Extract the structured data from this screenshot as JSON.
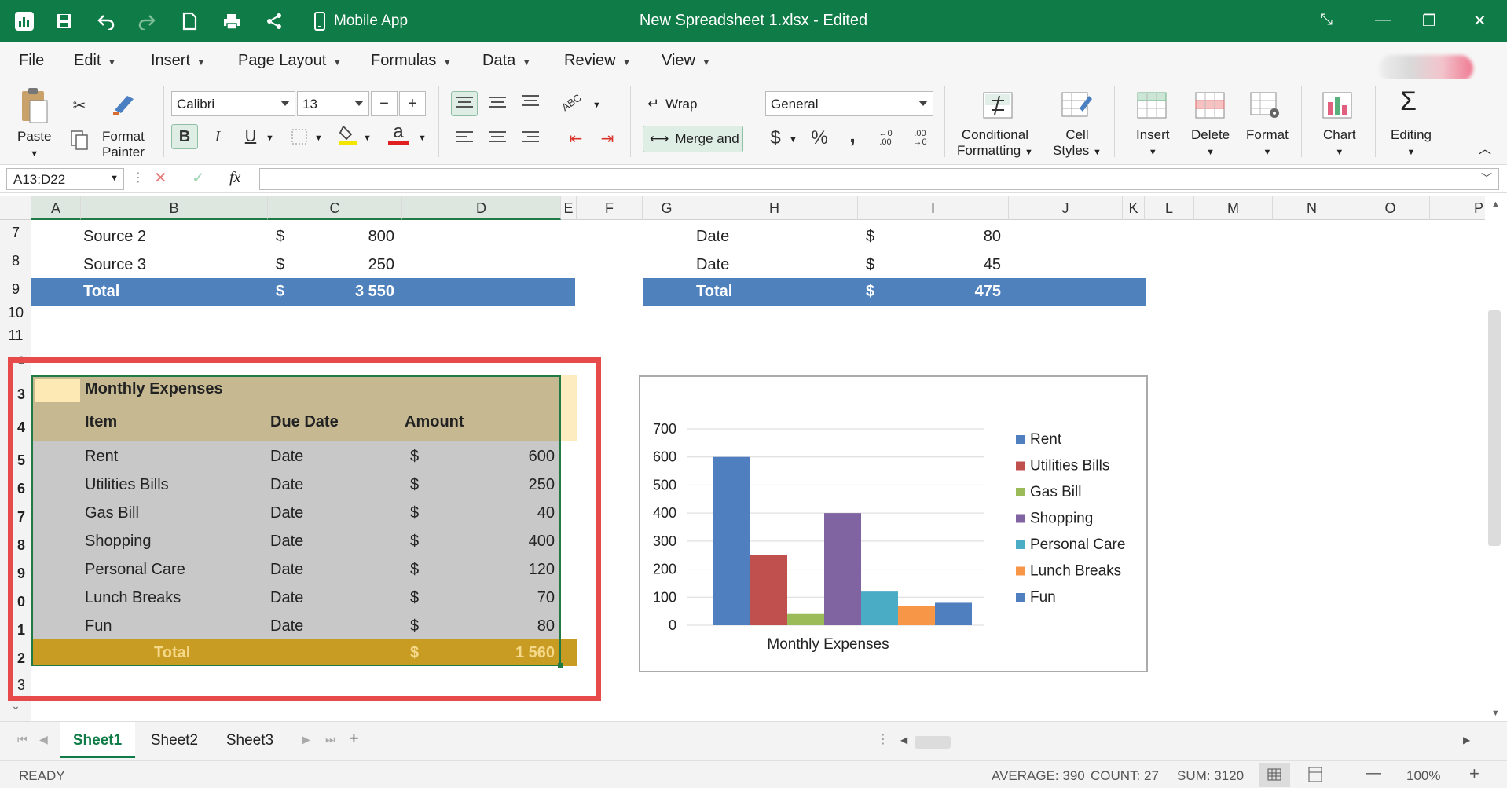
{
  "titlebar": {
    "mobile_label": "Mobile App",
    "title": "New Spreadsheet 1.xlsx - Edited"
  },
  "menu": [
    {
      "label": "File"
    },
    {
      "label": "Edit"
    },
    {
      "label": "Insert"
    },
    {
      "label": "Page Layout"
    },
    {
      "label": "Formulas"
    },
    {
      "label": "Data"
    },
    {
      "label": "Review"
    },
    {
      "label": "View"
    }
  ],
  "ribbon": {
    "paste": "Paste",
    "format_painter": [
      "Format",
      "Painter"
    ],
    "font_name": "Calibri",
    "font_size": "13",
    "wrap": "Wrap",
    "merge": "Merge and",
    "number_format": "General",
    "conditional": [
      "Conditional",
      "Formatting"
    ],
    "cell_styles": [
      "Cell",
      "Styles"
    ],
    "insert": "Insert",
    "delete": "Delete",
    "format": "Format",
    "chart": "Chart",
    "editing": "Editing",
    "bold": "B",
    "italic": "I",
    "underline": "U",
    "font_color_glyph": "a",
    "currency": "$",
    "percent": "%",
    "comma": ",",
    "sigma": "Σ",
    "abc": "ABC"
  },
  "formula_bar": {
    "name_box": "A13:D22",
    "fx": "fx",
    "value": ""
  },
  "columns": [
    "A",
    "B",
    "C",
    "D",
    "E",
    "F",
    "G",
    "H",
    "I",
    "J",
    "K",
    "L",
    "M",
    "N",
    "O",
    "P"
  ],
  "rows_top": [
    {
      "num": "7",
      "b": "Source 2",
      "c_sym": "$",
      "c_val": "800",
      "h": "Date",
      "i_sym": "$",
      "i_val": "80"
    },
    {
      "num": "8",
      "b": "Source 3",
      "c_sym": "$",
      "c_val": "250",
      "h": "Date",
      "i_sym": "$",
      "i_val": "45"
    }
  ],
  "total_row": {
    "num": "9",
    "left_label": "Total",
    "left_sym": "$",
    "left_val": "3 550",
    "right_label": "Total",
    "right_sym": "$",
    "right_val": "475"
  },
  "empty_rows": [
    "10",
    "11"
  ],
  "row_partial_12": "2",
  "expenses": {
    "title": "Monthly Expenses",
    "headers": {
      "item": "Item",
      "due": "Due Date",
      "amount": "Amount"
    },
    "row_nums": [
      "3",
      "4",
      "5",
      "6",
      "7",
      "8",
      "9",
      "0",
      "1",
      "2",
      "3"
    ],
    "rows": [
      {
        "item": "Rent",
        "due": "Date",
        "sym": "$",
        "amount": "600"
      },
      {
        "item": "Utilities Bills",
        "due": "Date",
        "sym": "$",
        "amount": "250"
      },
      {
        "item": "Gas Bill",
        "due": "Date",
        "sym": "$",
        "amount": "40"
      },
      {
        "item": "Shopping",
        "due": "Date",
        "sym": "$",
        "amount": "400"
      },
      {
        "item": "Personal Care",
        "due": "Date",
        "sym": "$",
        "amount": "120"
      },
      {
        "item": "Lunch Breaks",
        "due": "Date",
        "sym": "$",
        "amount": "70"
      },
      {
        "item": "Fun",
        "due": "Date",
        "sym": "$",
        "amount": "80"
      }
    ],
    "total": {
      "label": "Total",
      "sym": "$",
      "amount": "1 560"
    }
  },
  "chart_data": {
    "type": "bar",
    "categories": [
      "Monthly Expenses"
    ],
    "series": [
      {
        "name": "Rent",
        "values": [
          600
        ],
        "color": "#4f7fbf"
      },
      {
        "name": "Utilities Bills",
        "values": [
          250
        ],
        "color": "#c0504d"
      },
      {
        "name": "Gas Bill",
        "values": [
          40
        ],
        "color": "#9bbb59"
      },
      {
        "name": "Shopping",
        "values": [
          400
        ],
        "color": "#8064a2"
      },
      {
        "name": "Personal Care",
        "values": [
          120
        ],
        "color": "#4bacc6"
      },
      {
        "name": "Lunch Breaks",
        "values": [
          70
        ],
        "color": "#f79646"
      },
      {
        "name": "Fun",
        "values": [
          80
        ],
        "color": "#4f7fbf"
      }
    ],
    "yticks": [
      "0",
      "100",
      "200",
      "300",
      "400",
      "500",
      "600",
      "700"
    ],
    "ylim": [
      0,
      700
    ],
    "xlabel": "",
    "ylabel": "",
    "legend_position": "right",
    "grid": true
  },
  "tabs": [
    "Sheet1",
    "Sheet2",
    "Sheet3"
  ],
  "status": {
    "ready": "READY",
    "average": "AVERAGE: 390",
    "count": "COUNT: 27",
    "sum": "SUM: 3120",
    "zoom": "100%"
  },
  "colors": {
    "brand": "#0f7b46",
    "total_blue": "#4f81bd",
    "table_header": "#c6b992",
    "table_body": "#c8c8c8",
    "table_total": "#c89b23",
    "highlight": "#e64a4a"
  }
}
